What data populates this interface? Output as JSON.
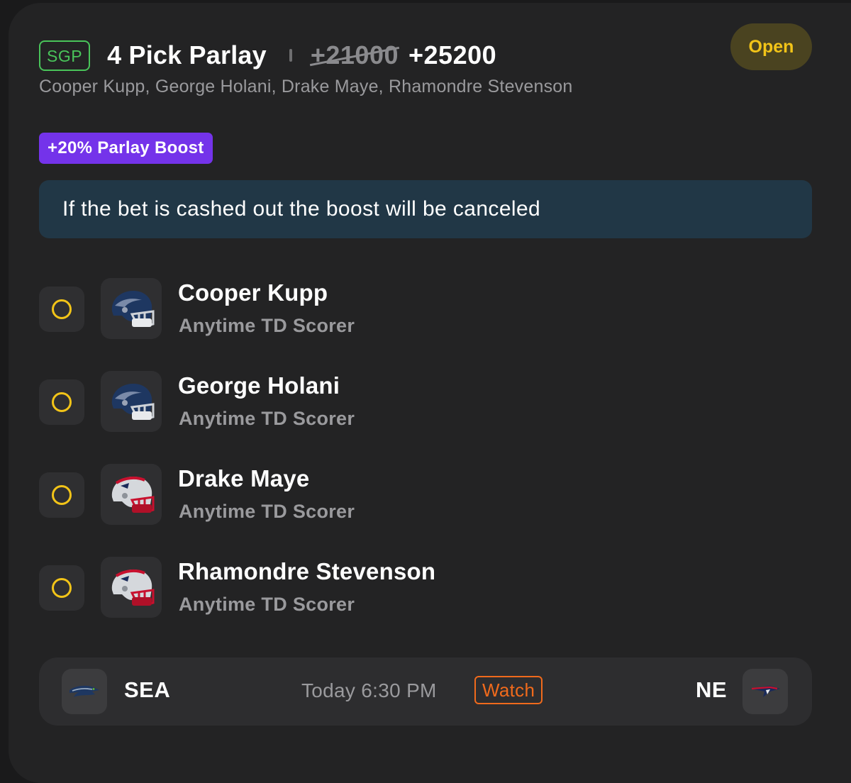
{
  "header": {
    "badge": "SGP",
    "title": "4 Pick Parlay",
    "original_odds": "+21000",
    "boosted_odds": "+25200",
    "status": "Open",
    "players_summary": "Cooper Kupp, George Holani, Drake Maye, Rhamondre Stevenson"
  },
  "boost": {
    "label": "+20% Parlay Boost",
    "notice": "If the bet is cashed out the boost will be canceled"
  },
  "picks": [
    {
      "player": "Cooper Kupp",
      "market": "Anytime TD Scorer",
      "team_icon": "seahawks-helmet-icon",
      "status_icon": "pending-ring-icon"
    },
    {
      "player": "George Holani",
      "market": "Anytime TD Scorer",
      "team_icon": "seahawks-helmet-icon",
      "status_icon": "pending-ring-icon"
    },
    {
      "player": "Drake Maye",
      "market": "Anytime TD Scorer",
      "team_icon": "patriots-helmet-icon",
      "status_icon": "pending-ring-icon"
    },
    {
      "player": "Rhamondre Stevenson",
      "market": "Anytime TD Scorer",
      "team_icon": "patriots-helmet-icon",
      "status_icon": "pending-ring-icon"
    }
  ],
  "game": {
    "home_team": "SEA",
    "away_team": "NE",
    "time": "Today 6:30 PM",
    "watch_label": "Watch",
    "home_logo": "seahawks-logo-icon",
    "away_logo": "patriots-logo-icon"
  },
  "colors": {
    "card_bg": "#232324",
    "sgp_green": "#49c45a",
    "status_yellow": "#f2c418",
    "boost_purple": "#7433ea",
    "notice_bg": "#213746",
    "watch_orange": "#f06a1c"
  }
}
